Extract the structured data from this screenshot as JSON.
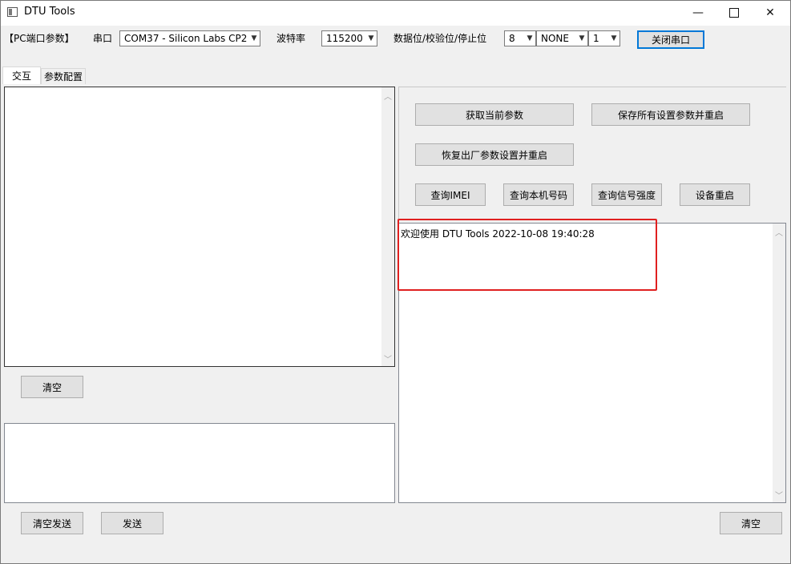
{
  "window": {
    "title": "DTU Tools",
    "min_glyph": "—",
    "close_glyph": "✕"
  },
  "port": {
    "section_label": "【PC端口参数】",
    "serial_label": "串口",
    "serial_value": "COM37 - Silicon Labs CP2",
    "baud_label": "波特率",
    "baud_value": "115200",
    "format_label": "数据位/校验位/停止位",
    "databits_value": "8",
    "parity_value": "NONE",
    "stopbits_value": "1",
    "close_port_button": "关闭串口"
  },
  "tabs": [
    {
      "label": "交互",
      "active": true
    },
    {
      "label": "参数配置",
      "active": false
    }
  ],
  "left": {
    "clear_button": "清空",
    "clear_send_button": "清空发送",
    "send_button": "发送"
  },
  "right": {
    "get_params_button": "获取当前参数",
    "save_restart_button": "保存所有设置参数并重启",
    "factory_reset_button": "恢复出厂参数设置并重启",
    "query_imei_button": "查询IMEI",
    "query_number_button": "查询本机号码",
    "query_signal_button": "查询信号强度",
    "restart_device_button": "设备重启",
    "log_lines": [
      "欢迎使用 DTU Tools 2022-10-08 19:40:28"
    ],
    "clear_button": "清空"
  },
  "icons": {
    "dropdown": "chevron-down-icon",
    "scroll_up": "scroll-up-arrow-icon",
    "scroll_down": "scroll-down-arrow-icon"
  },
  "colors": {
    "highlight": "#e02020",
    "focus_border": "#0078d7"
  }
}
